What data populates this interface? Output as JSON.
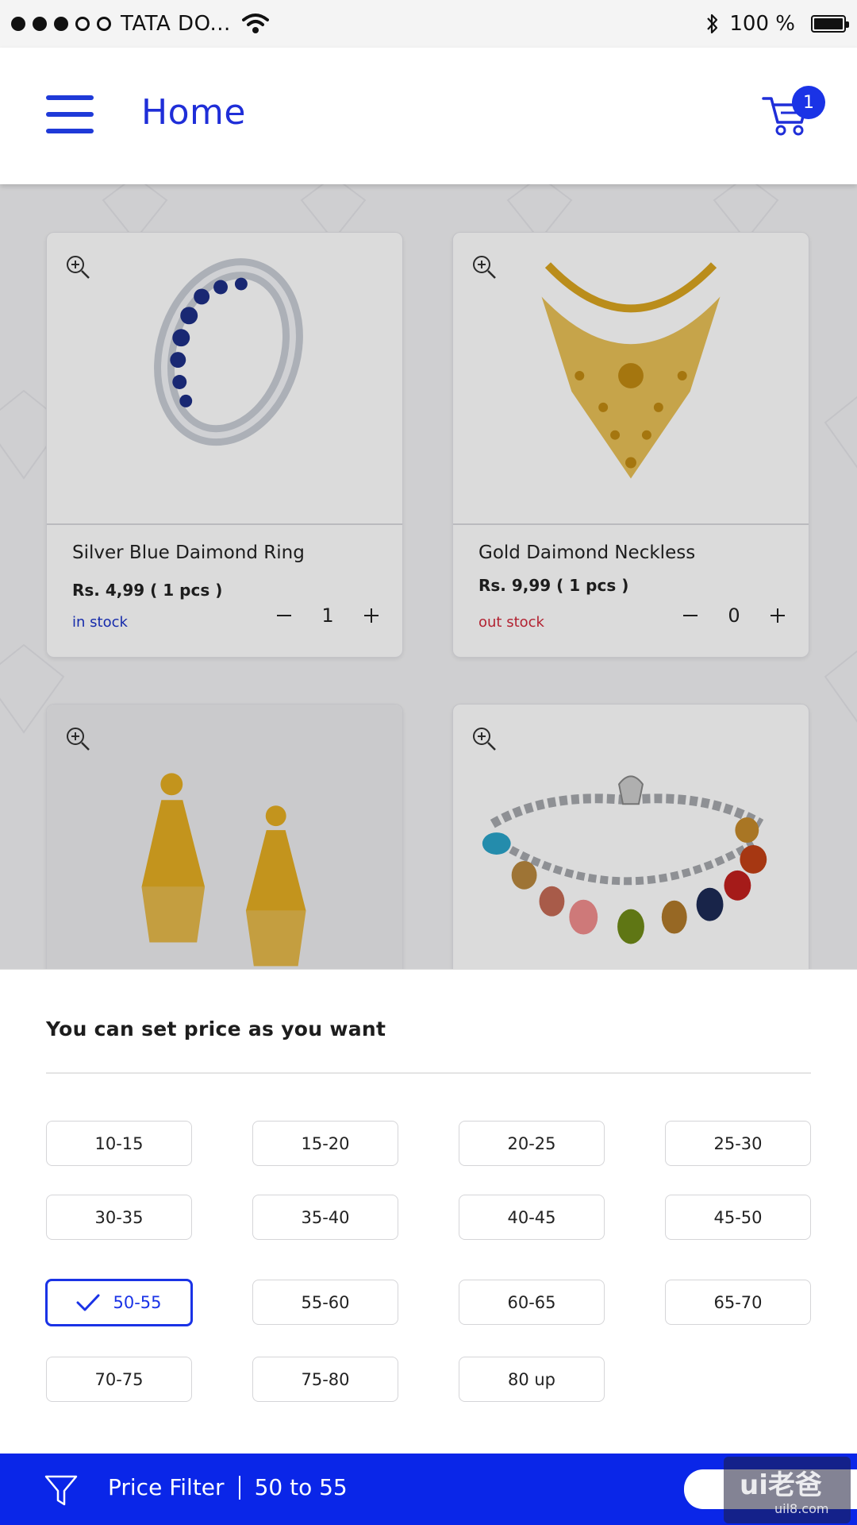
{
  "status_bar": {
    "carrier": "TATA DO...",
    "battery_text": "100 %",
    "signal_dots": [
      true,
      true,
      true,
      false,
      false
    ]
  },
  "header": {
    "title": "Home",
    "cart_count": "1",
    "accent_color": "#1F2ED8"
  },
  "products": [
    {
      "name": "Silver Blue Daimond Ring",
      "price": "Rs. 4,99  ( 1 pcs )",
      "stock": "in stock",
      "quantity": "1"
    },
    {
      "name": "Gold Daimond Neckless",
      "price": "Rs. 9,99 ( 1 pcs )",
      "stock": "out stock",
      "quantity": "0"
    },
    {
      "name": "",
      "price": "",
      "stock": "",
      "quantity": ""
    },
    {
      "name": "",
      "price": "",
      "stock": "",
      "quantity": ""
    }
  ],
  "price_sheet": {
    "title": "You can set price as you want",
    "ranges": [
      "10-15",
      "15-20",
      "20-25",
      "25-30",
      "30-35",
      "35-40",
      "40-45",
      "45-50",
      "50-55",
      "55-60",
      "60-65",
      "65-70",
      "70-75",
      "75-80",
      "80 up"
    ],
    "selected": "50-55"
  },
  "bottom_bar": {
    "label": "Price Filter",
    "value": "50 to 55",
    "background_color": "#0A26E8"
  },
  "watermark": {
    "main": "ui老爸",
    "sub": "uil8.com"
  }
}
